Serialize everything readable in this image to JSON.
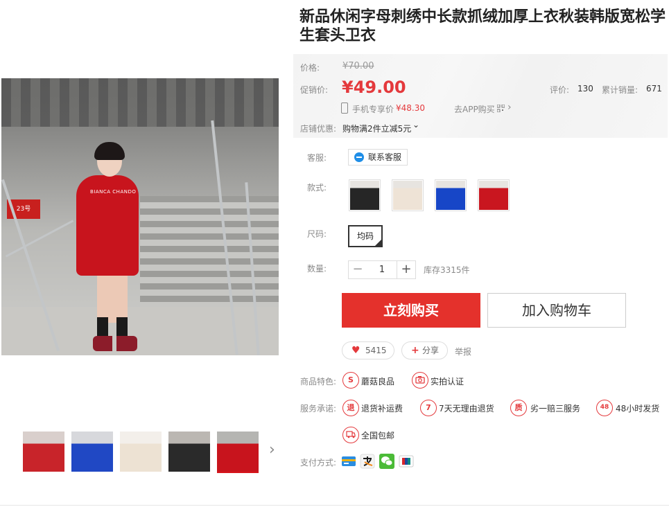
{
  "product": {
    "title": "新品休闲字母刺绣中长款抓绒加厚上衣秋装韩版宽松学生套头卫衣"
  },
  "price_panel": {
    "price_label": "价格:",
    "original_price": "¥70.00",
    "promo_label": "促销价:",
    "promo_price": "¥49.00",
    "rating_label": "评价:",
    "rating_count": "130",
    "sales_label": "累计销量:",
    "sales_count": "671",
    "mobile_label": "手机专享价",
    "mobile_price": "¥48.30",
    "app_label": "去APP购买",
    "app_chevron": "›",
    "store_promo_label": "店铺优惠:",
    "store_promo_value": "购物满2件立减5元",
    "store_promo_chevron": "⌄"
  },
  "service": {
    "label": "客服:",
    "button": "联系客服"
  },
  "styles": {
    "label": "款式:",
    "options": [
      {
        "name": "black",
        "color": "#262626"
      },
      {
        "name": "beige",
        "color": "#eee3d6"
      },
      {
        "name": "blue",
        "color": "#1746c7"
      },
      {
        "name": "red",
        "color": "#c9161f"
      }
    ]
  },
  "size": {
    "label": "尺码:",
    "selected": "均码"
  },
  "quantity": {
    "label": "数量:",
    "minus": "−",
    "value": "1",
    "plus": "+",
    "stock": "库存3315件"
  },
  "actions": {
    "buy": "立刻购买",
    "cart": "加入购物车"
  },
  "social": {
    "likes": "5415",
    "share": "分享",
    "report": "举报"
  },
  "features": {
    "label": "商品特色:",
    "items": [
      {
        "icon": "S",
        "text": "蘑菇良品"
      },
      {
        "icon": "camera-icon",
        "text": "实拍认证"
      }
    ]
  },
  "promises": {
    "label": "服务承诺:",
    "items": [
      {
        "icon": "退",
        "text": "退货补运费"
      },
      {
        "icon": "7",
        "text": "7天无理由退货"
      },
      {
        "icon": "质",
        "text": "劣一赔三服务"
      },
      {
        "icon": "48",
        "text": "48小时发货"
      },
      {
        "icon": "truck-icon",
        "text": "全国包邮"
      }
    ]
  },
  "payment": {
    "label": "支付方式:"
  },
  "gallery": {
    "sign_text": "23号",
    "hoodie_text": "BIANCA CHANDO",
    "thumbnails": [
      {
        "name": "red",
        "color": "#c8242a",
        "bg": "#d9cfcc"
      },
      {
        "name": "blue",
        "color": "#2048c4",
        "bg": "#d7d8dc"
      },
      {
        "name": "beige",
        "color": "#ede2d3",
        "bg": "#f3efea"
      },
      {
        "name": "black",
        "color": "#2a2a2a",
        "bg": "#bbb7b2"
      },
      {
        "name": "red-stairs",
        "color": "#c8141d",
        "bg": "#b5b5b2"
      }
    ],
    "next_arrow": "›"
  },
  "colors": {
    "accent": "#e4393c",
    "buy_button": "#e4312c"
  }
}
